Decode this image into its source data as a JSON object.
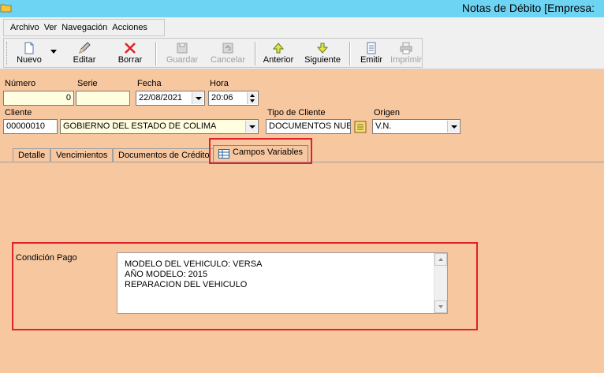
{
  "window": {
    "title": "Notas de Débito [Empresa:"
  },
  "menu": [
    "Archivo",
    "Ver",
    "Navegación",
    "Acciones"
  ],
  "toolbar": {
    "nuevo": "Nuevo",
    "editar": "Editar",
    "borrar": "Borrar",
    "guardar": "Guardar",
    "cancelar": "Cancelar",
    "anterior": "Anterior",
    "siguiente": "Siguiente",
    "emitir": "Emitir",
    "imprimir": "Imprimir"
  },
  "form": {
    "numero_label": "Número",
    "numero_value": "0",
    "serie_label": "Serie",
    "serie_value": "",
    "fecha_label": "Fecha",
    "fecha_value": "22/08/2021",
    "hora_label": "Hora",
    "hora_value": "20:06",
    "cliente_label": "Cliente",
    "cliente_code": "00000010",
    "cliente_name": "GOBIERNO DEL ESTADO DE COLIMA",
    "tipo_label": "Tipo de Cliente",
    "tipo_value": "DOCUMENTOS NUEVOS",
    "origen_label": "Origen",
    "origen_value": "V.N."
  },
  "tabs": [
    "Detalle",
    "Vencimientos",
    "Documentos de Crédito",
    "Campos Variables"
  ],
  "campos": {
    "condicion_label": "Condición Pago",
    "lines": [
      "MODELO DEL VEHICULO: VERSA",
      "AÑO MODELO: 2015",
      "REPARACION DEL VEHICULO"
    ]
  },
  "colors": {
    "background": "#f7c7a0",
    "titlebar": "#6ed4f4",
    "highlight": "#e0202a"
  }
}
